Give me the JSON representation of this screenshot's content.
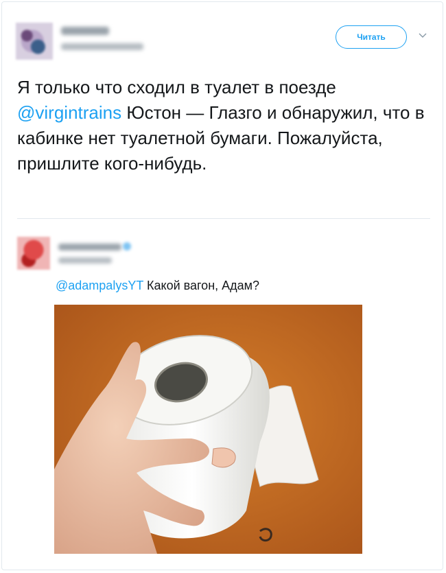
{
  "tweet": {
    "follow_label": "Читать",
    "text_part1": "Я только что сходил в туалет в поезде ",
    "mention": "@virgintrains",
    "text_part2": " Юстон — Глазго и обнаружил, что в кабинке нет туалетной бумаги. Пожалуйста, пришлите кого-нибудь."
  },
  "reply": {
    "mention": "@adampalysYT",
    "text": " Какой вагон, Адам?",
    "photo_icon": "toilet-paper-photo"
  },
  "colors": {
    "accent": "#1da1f2",
    "text": "#14171a",
    "border": "#e1e8ed",
    "photo_background": "#c96a1e"
  }
}
